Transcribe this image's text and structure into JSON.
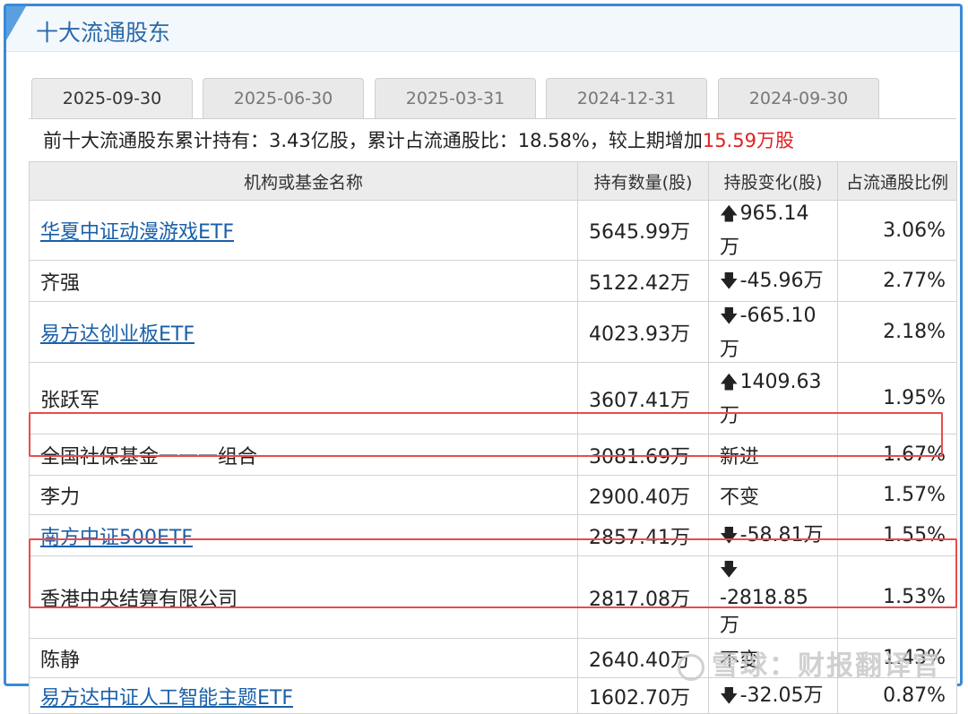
{
  "header": {
    "title": "十大流通股东"
  },
  "tabs": [
    {
      "label": "2025-09-30",
      "active": true
    },
    {
      "label": "2025-06-30",
      "active": false
    },
    {
      "label": "2025-03-31",
      "active": false
    },
    {
      "label": "2024-12-31",
      "active": false
    },
    {
      "label": "2024-09-30",
      "active": false
    }
  ],
  "summary": {
    "text": "前十大流通股东累计持有：3.43亿股，累计占流通股比：18.58%，较上期增加",
    "increase": "15.59万股"
  },
  "table": {
    "headers": [
      "机构或基金名称",
      "持有数量(股)",
      "持股变化(股)",
      "占流通股比例"
    ],
    "rows": [
      {
        "name": "华夏中证动漫游戏ETF",
        "link": true,
        "hold": "5645.99万",
        "change": "965.14万",
        "dir": "up",
        "pct": "3.06%"
      },
      {
        "name": "齐强",
        "link": false,
        "hold": "5122.42万",
        "change": "-45.96万",
        "dir": "down",
        "pct": "2.77%"
      },
      {
        "name": "易方达创业板ETF",
        "link": true,
        "hold": "4023.93万",
        "change": "-665.10万",
        "dir": "down",
        "pct": "2.18%"
      },
      {
        "name": "张跃军",
        "link": false,
        "hold": "3607.41万",
        "change": "1409.63万",
        "dir": "up",
        "pct": "1.95%"
      },
      {
        "name": "全国社保基金一一一组合",
        "link": false,
        "hold": "3081.69万",
        "change": "新进",
        "dir": "new",
        "pct": "1.67%"
      },
      {
        "name": "李力",
        "link": false,
        "hold": "2900.40万",
        "change": "不变",
        "dir": "same",
        "pct": "1.57%"
      },
      {
        "name": "南方中证500ETF",
        "link": true,
        "hold": "2857.41万",
        "change": "-58.81万",
        "dir": "down",
        "pct": "1.55%"
      },
      {
        "name": "香港中央结算有限公司",
        "link": false,
        "hold": "2817.08万",
        "change": "-2818.85万",
        "dir": "down",
        "pct": "1.53%"
      },
      {
        "name": "陈静",
        "link": false,
        "hold": "2640.40万",
        "change": "不变",
        "dir": "same",
        "pct": "1.43%"
      },
      {
        "name": "易方达中证人工智能主题ETF",
        "link": true,
        "hold": "1602.70万",
        "change": "-32.05万",
        "dir": "down",
        "pct": "0.87%"
      }
    ]
  },
  "watermark": "雪球：财报翻译官",
  "colors": {
    "up": "#e02020",
    "down": "#3aa82a",
    "link": "#1a5fa8",
    "highlight": "#e94b4b"
  }
}
